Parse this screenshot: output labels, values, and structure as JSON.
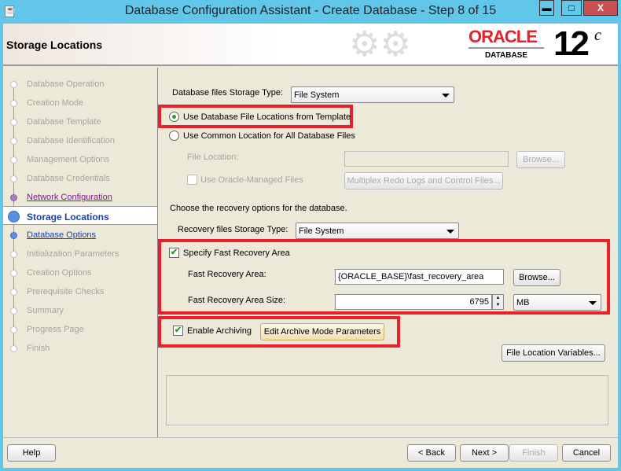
{
  "window": {
    "title": "Database Configuration Assistant - Create Database - Step 8 of 15",
    "minimize": "▬",
    "maximize": "□",
    "close": "X"
  },
  "header": {
    "title": "Storage Locations",
    "logo_oracle": "ORACLE",
    "logo_database": "DATABASE",
    "logo_version": "12",
    "logo_c": "c"
  },
  "steps": [
    {
      "label": "Database Operation",
      "state": "disabled"
    },
    {
      "label": "Creation Mode",
      "state": "disabled"
    },
    {
      "label": "Database Template",
      "state": "disabled"
    },
    {
      "label": "Database Identification",
      "state": "disabled"
    },
    {
      "label": "Management Options",
      "state": "disabled"
    },
    {
      "label": "Database Credentials",
      "state": "disabled"
    },
    {
      "label": "Network Configuration",
      "state": "visited"
    },
    {
      "label": "Storage Locations",
      "state": "current"
    },
    {
      "label": "Database Options",
      "state": "next"
    },
    {
      "label": "Initialization Parameters",
      "state": "disabled"
    },
    {
      "label": "Creation Options",
      "state": "disabled"
    },
    {
      "label": "Prerequisite Checks",
      "state": "disabled"
    },
    {
      "label": "Summary",
      "state": "disabled"
    },
    {
      "label": "Progress Page",
      "state": "disabled"
    },
    {
      "label": "Finish",
      "state": "disabled"
    }
  ],
  "main": {
    "db_storage_label": "Database files Storage Type:",
    "db_storage_value": "File System",
    "radio_template": "Use Database File Locations from Template",
    "radio_common": "Use Common Location for All Database Files",
    "file_location_label": "File Location:",
    "file_location_value": "",
    "browse1": "Browse...",
    "omf_label": "Use Oracle-Managed Files",
    "multiplex_button": "Multiplex Redo Logs and Control Files...",
    "recovery_intro": "Choose the recovery options for the database.",
    "recovery_storage_label": "Recovery files Storage Type:",
    "recovery_storage_value": "File System",
    "specify_fra": "Specify Fast Recovery Area",
    "fra_label": "Fast Recovery Area:",
    "fra_value": "{ORACLE_BASE}\\fast_recovery_area",
    "browse2": "Browse...",
    "fra_size_label": "Fast Recovery Area Size:",
    "fra_size_value": "6795",
    "fra_unit": "MB",
    "enable_archiving": "Enable Archiving",
    "edit_archive": "Edit Archive Mode Parameters",
    "file_location_variables": "File Location Variables..."
  },
  "footer": {
    "help": "Help",
    "back": "< Back",
    "next": "Next >",
    "finish": "Finish",
    "cancel": "Cancel"
  }
}
